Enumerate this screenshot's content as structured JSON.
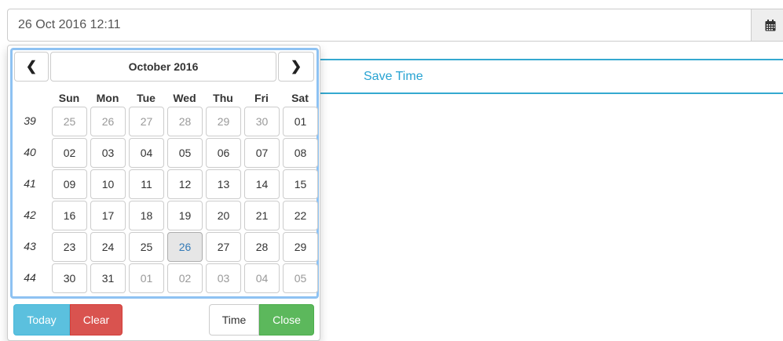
{
  "date_field": {
    "value": "26 Oct 2016 12:11"
  },
  "calendar_icon": "calendar-icon",
  "save_time_label": "Save Time",
  "picker": {
    "prev_icon": "chevron-left-icon",
    "next_icon": "chevron-right-icon",
    "prev_glyph": "❮",
    "next_glyph": "❯",
    "month_label": "October 2016",
    "weekdays": [
      "Sun",
      "Mon",
      "Tue",
      "Wed",
      "Thu",
      "Fri",
      "Sat"
    ],
    "weeks": [
      {
        "number": "39",
        "days": [
          {
            "label": "25",
            "muted": true
          },
          {
            "label": "26",
            "muted": true
          },
          {
            "label": "27",
            "muted": true
          },
          {
            "label": "28",
            "muted": true
          },
          {
            "label": "29",
            "muted": true
          },
          {
            "label": "30",
            "muted": true
          },
          {
            "label": "01"
          }
        ]
      },
      {
        "number": "40",
        "days": [
          {
            "label": "02"
          },
          {
            "label": "03"
          },
          {
            "label": "04"
          },
          {
            "label": "05"
          },
          {
            "label": "06"
          },
          {
            "label": "07"
          },
          {
            "label": "08"
          }
        ]
      },
      {
        "number": "41",
        "days": [
          {
            "label": "09"
          },
          {
            "label": "10"
          },
          {
            "label": "11"
          },
          {
            "label": "12"
          },
          {
            "label": "13"
          },
          {
            "label": "14"
          },
          {
            "label": "15"
          }
        ]
      },
      {
        "number": "42",
        "days": [
          {
            "label": "16"
          },
          {
            "label": "17"
          },
          {
            "label": "18"
          },
          {
            "label": "19"
          },
          {
            "label": "20"
          },
          {
            "label": "21"
          },
          {
            "label": "22"
          }
        ]
      },
      {
        "number": "43",
        "days": [
          {
            "label": "23"
          },
          {
            "label": "24"
          },
          {
            "label": "25"
          },
          {
            "label": "26",
            "active": true
          },
          {
            "label": "27"
          },
          {
            "label": "28"
          },
          {
            "label": "29"
          }
        ]
      },
      {
        "number": "44",
        "days": [
          {
            "label": "30"
          },
          {
            "label": "31"
          },
          {
            "label": "01",
            "muted": true
          },
          {
            "label": "02",
            "muted": true
          },
          {
            "label": "03",
            "muted": true
          },
          {
            "label": "04",
            "muted": true
          },
          {
            "label": "05",
            "muted": true
          }
        ]
      }
    ],
    "footer": {
      "today": "Today",
      "clear": "Clear",
      "time": "Time",
      "close": "Close"
    }
  },
  "colors": {
    "accent": "#35a9d0",
    "today": "#5bc0de",
    "clear": "#d9534f",
    "close": "#5cb85c",
    "active_day_text": "#337ab7",
    "picker_focus_border": "#8ec2f2"
  }
}
